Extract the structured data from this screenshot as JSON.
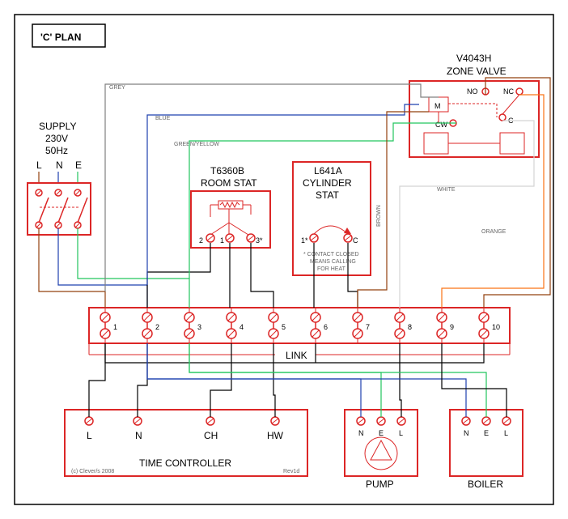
{
  "title": "'C' PLAN",
  "supply": {
    "label1": "SUPPLY",
    "label2": "230V",
    "label3": "50Hz",
    "L": "L",
    "N": "N",
    "E": "E"
  },
  "room_stat": {
    "label1": "T6360B",
    "label2": "ROOM STAT",
    "t1": "1",
    "t2": "2",
    "t3": "3*"
  },
  "cyl_stat": {
    "label1": "L641A",
    "label2": "CYLINDER",
    "label3": "STAT",
    "t1": "1*",
    "t2": "C",
    "note1": "* CONTACT CLOSED",
    "note2": "MEANS CALLING",
    "note3": "FOR HEAT"
  },
  "zone_valve": {
    "label1": "V4043H",
    "label2": "ZONE VALVE",
    "M": "M",
    "NO": "NO",
    "NC": "NC",
    "CW": "CW",
    "C": "C"
  },
  "strip": {
    "link": "LINK",
    "t1": "1",
    "t2": "2",
    "t3": "3",
    "t4": "4",
    "t5": "5",
    "t6": "6",
    "t7": "7",
    "t8": "8",
    "t9": "9",
    "t10": "10"
  },
  "time_ctrl": {
    "label": "TIME CONTROLLER",
    "L": "L",
    "N": "N",
    "CH": "CH",
    "HW": "HW",
    "rev": "Rev1d",
    "copy": "(c) Clever/s 2008"
  },
  "pump": {
    "label": "PUMP",
    "N": "N",
    "E": "E",
    "L": "L"
  },
  "boiler": {
    "label": "BOILER",
    "N": "N",
    "E": "E",
    "L": "L"
  },
  "wire_labels": {
    "grey": "GREY",
    "blue": "BLUE",
    "gy": "GREEN/YELLOW",
    "brown": "BROWN",
    "white": "WHITE",
    "orange": "ORANGE"
  }
}
